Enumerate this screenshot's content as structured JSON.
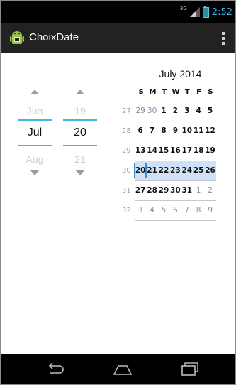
{
  "status": {
    "network": "3G",
    "time": "2:52"
  },
  "app": {
    "title": "ChoixDate"
  },
  "month_picker": {
    "prev": "Jun",
    "current": "Jul",
    "next": "Aug"
  },
  "day_picker": {
    "prev": "19",
    "current": "20",
    "next": "21"
  },
  "calendar": {
    "title": "July 2014",
    "days_of_week": [
      "S",
      "M",
      "T",
      "W",
      "T",
      "F",
      "S"
    ],
    "weeks": [
      {
        "num": "27",
        "days": [
          "29",
          "30",
          "1",
          "2",
          "3",
          "4",
          "5"
        ],
        "other": [
          true,
          true,
          false,
          false,
          false,
          false,
          false
        ]
      },
      {
        "num": "28",
        "days": [
          "6",
          "7",
          "8",
          "9",
          "10",
          "11",
          "12"
        ],
        "other": [
          false,
          false,
          false,
          false,
          false,
          false,
          false
        ]
      },
      {
        "num": "29",
        "days": [
          "13",
          "14",
          "15",
          "16",
          "17",
          "18",
          "19"
        ],
        "other": [
          false,
          false,
          false,
          false,
          false,
          false,
          false
        ]
      },
      {
        "num": "30",
        "days": [
          "20",
          "21",
          "22",
          "23",
          "24",
          "25",
          "26"
        ],
        "other": [
          false,
          false,
          false,
          false,
          false,
          false,
          false
        ],
        "selected": true
      },
      {
        "num": "31",
        "days": [
          "27",
          "28",
          "29",
          "30",
          "31",
          "1",
          "2"
        ],
        "other": [
          false,
          false,
          false,
          false,
          false,
          true,
          true
        ]
      },
      {
        "num": "32",
        "days": [
          "3",
          "4",
          "5",
          "6",
          "7",
          "8",
          "9"
        ],
        "other": [
          true,
          true,
          true,
          true,
          true,
          true,
          true
        ]
      }
    ]
  }
}
